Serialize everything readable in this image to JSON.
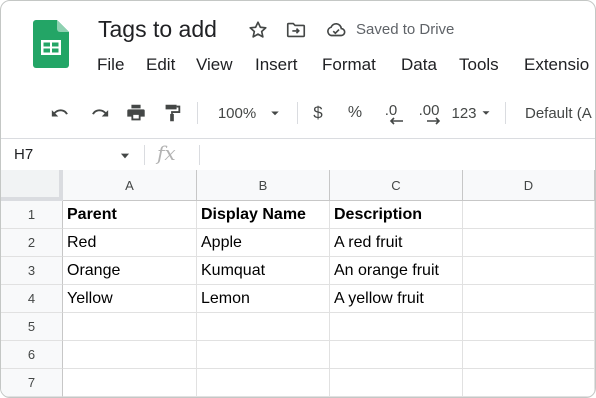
{
  "header": {
    "doc_title": "Tags to add",
    "save_status": "Saved to Drive",
    "icons": [
      "sheets-logo-icon",
      "star-icon",
      "move-folder-icon",
      "cloud-done-icon"
    ]
  },
  "menu": [
    "File",
    "Edit",
    "View",
    "Insert",
    "Format",
    "Data",
    "Tools",
    "Extensio"
  ],
  "toolbar": {
    "zoom": "100%",
    "currency": "$",
    "percent": "%",
    "decrease_decimal": ".0",
    "increase_decimal": ".00",
    "more_formats": "123",
    "font": "Default (A"
  },
  "formula_bar": {
    "name_box": "H7",
    "fx_icon": "fx",
    "value": ""
  },
  "grid": {
    "columns": [
      "A",
      "B",
      "C",
      "D"
    ],
    "rows": [
      "1",
      "2",
      "3",
      "4",
      "5",
      "6",
      "7"
    ],
    "cells": [
      [
        "Parent",
        "Display Name",
        "Description",
        ""
      ],
      [
        "Red",
        "Apple",
        "A red fruit",
        ""
      ],
      [
        "Orange",
        "Kumquat",
        "An orange fruit",
        ""
      ],
      [
        "Yellow",
        "Lemon",
        "A yellow fruit",
        ""
      ],
      [
        "",
        "",
        "",
        ""
      ],
      [
        "",
        "",
        "",
        ""
      ],
      [
        "",
        "",
        "",
        ""
      ]
    ]
  },
  "colors": {
    "sheets_green": "#23a566",
    "header_bg": "#f8f9fa",
    "grid_line": "#e1e1e1",
    "icon_gray": "#444746"
  }
}
